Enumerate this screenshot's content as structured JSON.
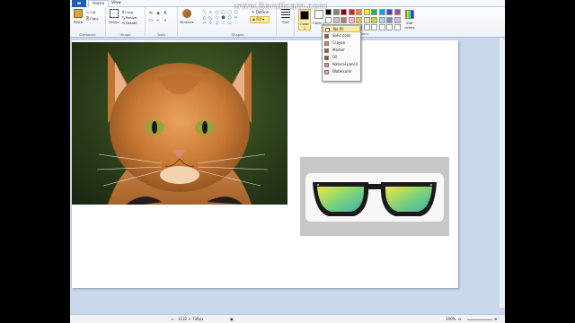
{
  "watermark": "www.Bandicam.com",
  "ribbon": {
    "tabs": [
      "Home",
      "View"
    ],
    "clipboard": {
      "paste": "Paste",
      "cut": "Cut",
      "copy": "Copy",
      "label": "Clipboard"
    },
    "image": {
      "select": "Select",
      "crop": "Crop",
      "resize": "Resize",
      "rotate": "Rotate",
      "label": "Image"
    },
    "tools": {
      "label": "Tools",
      "brushes": "Brushes"
    },
    "shapes": {
      "label": "Shapes",
      "outline": "Outline",
      "fill": "Fill"
    },
    "size": "Size",
    "colors": {
      "color1": "Color 1",
      "color2": "Color 2",
      "edit": "Edit colors",
      "label": "Colors"
    }
  },
  "fill_menu": {
    "items": [
      "No fill",
      "Solid color",
      "Crayon",
      "Marker",
      "Oil",
      "Natural pencil",
      "Watercolor"
    ],
    "selected": "No fill"
  },
  "palette": [
    "#000000",
    "#7f7f7f",
    "#880015",
    "#ed1c24",
    "#ff7f27",
    "#fff200",
    "#22b14c",
    "#00a2e8",
    "#3f48cc",
    "#a349a4",
    "#ffffff",
    "#c3c3c3",
    "#b97a57",
    "#ffaec9",
    "#ffc90e",
    "#efe4b0",
    "#b5e61d",
    "#99d9ea",
    "#7092be",
    "#c8bfe7",
    "#ffffff",
    "#ffffff",
    "#ffffff",
    "#ffffff",
    "#ffffff",
    "#ffffff",
    "#ffffff",
    "#ffffff",
    "#ffffff",
    "#ffffff"
  ],
  "colors_current": {
    "color1": "#000000",
    "color2": "#ffffff"
  },
  "status": {
    "dimensions": "1132 × 736px",
    "zoom": "100%"
  }
}
